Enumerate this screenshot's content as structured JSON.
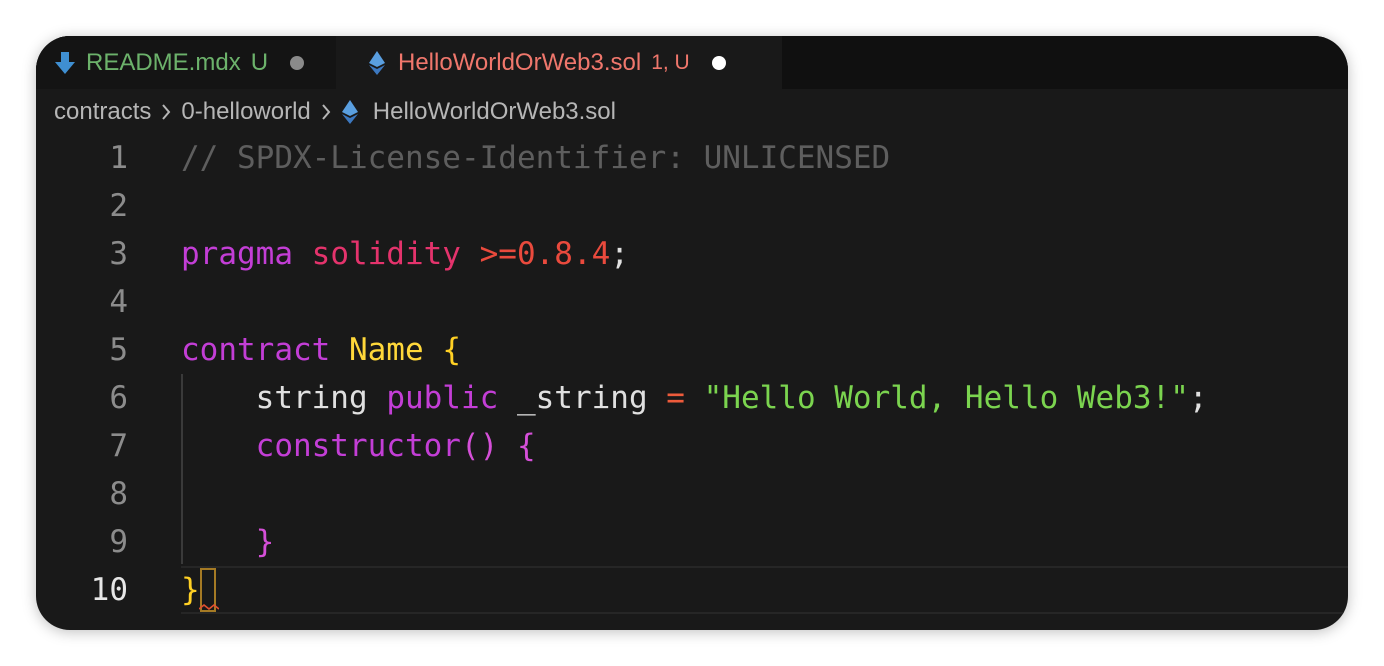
{
  "tabs": [
    {
      "name": "README.mdx",
      "status": "U",
      "icon": "download-arrow-icon",
      "active": false
    },
    {
      "name": "HelloWorldOrWeb3.sol",
      "status": "1, U",
      "icon": "ethereum-icon",
      "active": true
    }
  ],
  "breadcrumb": {
    "items": [
      "contracts",
      "0-helloworld",
      "HelloWorldOrWeb3.sol"
    ],
    "separator_icon": "chevron-right-icon",
    "file_icon": "ethereum-icon"
  },
  "editor": {
    "current_line": "10",
    "lines": [
      {
        "num": "1",
        "tokens": [
          {
            "text": "// SPDX-License-Identifier: UNLICENSED",
            "kind": "comment"
          }
        ]
      },
      {
        "num": "2",
        "tokens": []
      },
      {
        "num": "3",
        "tokens": [
          {
            "text": "pragma",
            "kind": "kw"
          },
          {
            "text": " ",
            "kind": "plain"
          },
          {
            "text": "solidity",
            "kind": "sol"
          },
          {
            "text": " ",
            "kind": "plain"
          },
          {
            "text": ">=0.8.4",
            "kind": "ver"
          },
          {
            "text": ";",
            "kind": "plain"
          }
        ]
      },
      {
        "num": "4",
        "tokens": []
      },
      {
        "num": "5",
        "tokens": [
          {
            "text": "contract",
            "kind": "kw"
          },
          {
            "text": " ",
            "kind": "plain"
          },
          {
            "text": "Name",
            "kind": "type"
          },
          {
            "text": " ",
            "kind": "plain"
          },
          {
            "text": "{",
            "kind": "brace-y"
          }
        ]
      },
      {
        "num": "6",
        "tokens": [
          {
            "text": "    string",
            "kind": "plain"
          },
          {
            "text": " ",
            "kind": "plain"
          },
          {
            "text": "public",
            "kind": "kw"
          },
          {
            "text": " _string ",
            "kind": "plain"
          },
          {
            "text": "=",
            "kind": "op"
          },
          {
            "text": " ",
            "kind": "plain"
          },
          {
            "text": "\"Hello World, Hello Web3!\"",
            "kind": "str"
          },
          {
            "text": ";",
            "kind": "plain"
          }
        ]
      },
      {
        "num": "7",
        "tokens": [
          {
            "text": "    constructor",
            "kind": "kw"
          },
          {
            "text": "()",
            "kind": "brace-p"
          },
          {
            "text": " ",
            "kind": "plain"
          },
          {
            "text": "{",
            "kind": "brace-p"
          }
        ]
      },
      {
        "num": "8",
        "tokens": []
      },
      {
        "num": "9",
        "tokens": [
          {
            "text": "    }",
            "kind": "brace-p"
          }
        ]
      },
      {
        "num": "10",
        "tokens": [
          {
            "text": "}",
            "kind": "brace-y"
          }
        ]
      }
    ]
  },
  "colors": {
    "editor_bg": "#191919",
    "tab_modified_green": "#6cb26b",
    "tab_error_red": "#f0776c",
    "keyword": "#c33ed6",
    "string": "#7bd44f",
    "type": "#ffd83a",
    "comment": "#5e5e5e"
  }
}
